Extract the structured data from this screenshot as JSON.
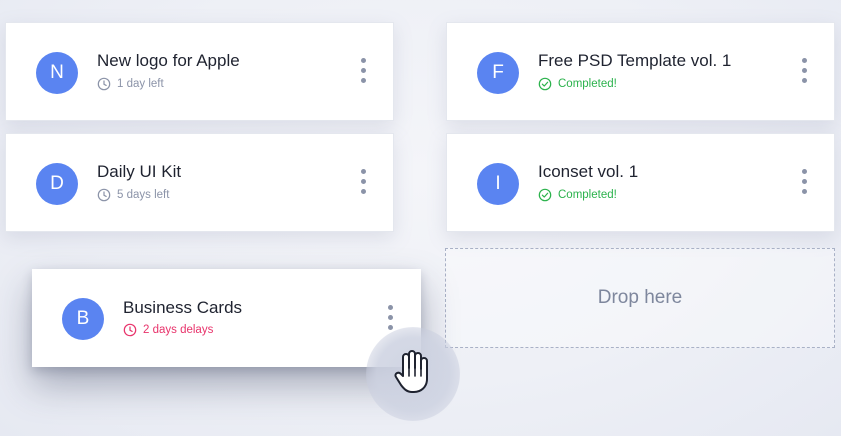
{
  "colors": {
    "avatar": "#5a84f1",
    "pending": "#8b93a8",
    "completed": "#2bb24c",
    "delayed": "#e8336b"
  },
  "cards": [
    {
      "initial": "N",
      "title": "New logo for Apple",
      "status": "1 day left",
      "status_icon": "clock-icon",
      "status_type": "pending"
    },
    {
      "initial": "F",
      "title": "Free PSD Template vol. 1",
      "status": "Completed!",
      "status_icon": "check-circle-icon",
      "status_type": "completed"
    },
    {
      "initial": "D",
      "title": "Daily UI Kit",
      "status": "5 days left",
      "status_icon": "clock-icon",
      "status_type": "pending"
    },
    {
      "initial": "I",
      "title": "Iconset vol. 1",
      "status": "Completed!",
      "status_icon": "check-circle-icon",
      "status_type": "completed"
    },
    {
      "initial": "B",
      "title": "Business Cards",
      "status": "2 days delays",
      "status_icon": "clock-icon",
      "status_type": "delayed"
    }
  ],
  "drop_zone": {
    "label": "Drop here"
  },
  "cursor": {
    "icon": "hand-grab-cursor-icon"
  }
}
